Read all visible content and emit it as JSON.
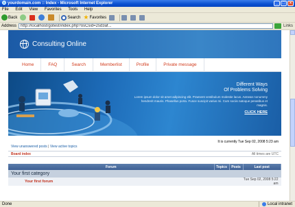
{
  "window": {
    "title": "yourdomain.com :: Index - Microsoft Internet Explorer",
    "controls": [
      "_",
      "□",
      "×"
    ]
  },
  "menu": [
    "File",
    "Edit",
    "View",
    "Favorites",
    "Tools",
    "Help"
  ],
  "toolbar": {
    "back": "Back",
    "search": "Search",
    "favorites": "Favorites"
  },
  "address": {
    "label": "Address",
    "url": "http://localhost/gotest/index.php?osCsid=2sd3af...",
    "links": "Links"
  },
  "status": {
    "text": "Done",
    "zone": "Local intranet"
  },
  "site": {
    "logo": "Consulting Online",
    "nav": [
      "Home",
      "FAQ",
      "Search",
      "Memberlist",
      "Profile",
      "Private message"
    ],
    "banner": {
      "title_line1": "Different Ways",
      "title_line2": "Of Problems Solving",
      "text": "Lorem ipsum dolor sit amet adipiscing elit. Praesent vestibulum molestie lacus. Aenean nonummy hendrerit mauris. Phasellus porta. Fusce suscipit varius mi. Cum sociis natoque penatibus et magnis.",
      "link": "CLICK HERE"
    },
    "forum": {
      "time": "It is currently Tue Sep 02, 2008 5:23 am",
      "link_unanswered": "View unanswered posts",
      "link_active": "View active topics",
      "board_index": "Board index",
      "timezone": "All times are UTC",
      "headers": {
        "forum": "Forum",
        "topics": "Topics",
        "posts": "Posts",
        "last_post": "Last post"
      },
      "category": "Your first category",
      "first_forum": "Your first forum",
      "first_forum_last_post": "Tue Sep 02, 2008 5:22 am"
    }
  }
}
